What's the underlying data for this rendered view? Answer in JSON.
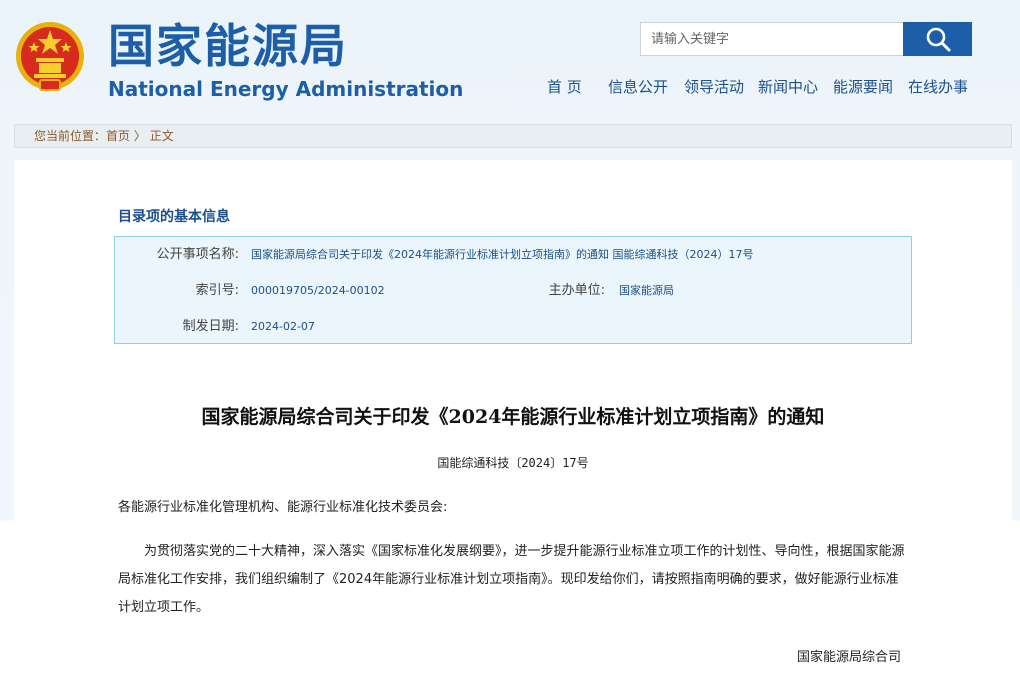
{
  "header": {
    "title_cn": "国家能源局",
    "title_en": "National Energy Administration",
    "search_placeholder": "请输入关键字",
    "emblem_icon": "national-emblem-icon",
    "search_icon": "magnifier-icon"
  },
  "nav": {
    "items": [
      {
        "label": "首 页"
      },
      {
        "label": "信息公开"
      },
      {
        "label": "领导活动"
      },
      {
        "label": "新闻中心"
      },
      {
        "label": "能源要闻"
      },
      {
        "label": "在线办事"
      }
    ]
  },
  "breadcrumb": {
    "prefix": "您当前位置：",
    "home": "首页",
    "separator": " 〉",
    "current": "正文"
  },
  "meta": {
    "heading": "目录项的基本信息",
    "rows": {
      "name_label": "公开事项名称:",
      "name_value": "国家能源局综合司关于印发《2024年能源行业标准计划立项指南》的通知 国能综通科技（2024）17号",
      "index_label": "索引号:",
      "index_value": "000019705/2024-00102",
      "org_label": "主办单位:",
      "org_value": "国家能源局",
      "date_label": "制发日期:",
      "date_value": "2024-02-07"
    }
  },
  "document": {
    "title": "国家能源局综合司关于印发《2024年能源行业标准计划立项指南》的通知",
    "number": "国能综通科技〔2024〕17号",
    "salutation": "各能源行业标准化管理机构、能源行业标准化技术委员会:",
    "body": "为贯彻落实党的二十大精神，深入落实《国家标准化发展纲要》，进一步提升能源行业标准立项工作的计划性、导向性，根据国家能源局标准化工作安排，我们组织编制了《2024年能源行业标准计划立项指南》。现印发给你们，请按照指南明确的要求，做好能源行业标准计划立项工作。",
    "signature": "国家能源局综合司"
  },
  "colors": {
    "brand_blue": "#1c5ea8",
    "meta_box_bg": "#eaf6fb",
    "meta_box_border": "#8fcfe3"
  }
}
